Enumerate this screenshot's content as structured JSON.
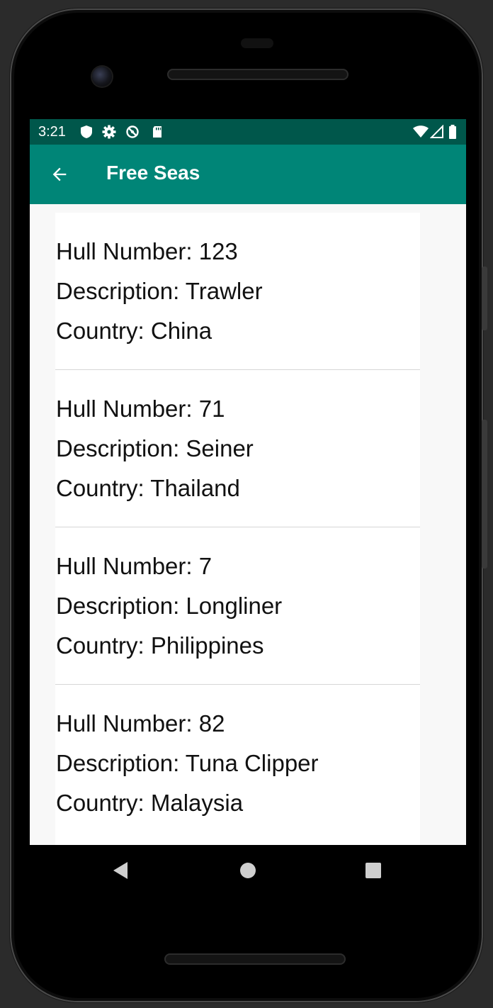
{
  "status_bar": {
    "time": "3:21",
    "icons": [
      "shield-icon",
      "gear-icon",
      "no-sync-icon",
      "sd-card-icon"
    ],
    "right_icons": [
      "wifi-icon",
      "signal-icon",
      "battery-icon"
    ]
  },
  "app_bar": {
    "title": "Free Seas",
    "back_icon": "arrow-back-icon",
    "color": "#008577",
    "status_color": "#00574b"
  },
  "vessels": [
    {
      "hull": "Hull Number: 123",
      "description": "Description: Trawler",
      "country": "Country: China"
    },
    {
      "hull": "Hull Number: 71",
      "description": "Description: Seiner",
      "country": "Country: Thailand"
    },
    {
      "hull": "Hull Number: 7",
      "description": "Description: Longliner",
      "country": "Country: Philippines"
    },
    {
      "hull": "Hull Number: 82",
      "description": "Description: Tuna Clipper",
      "country": "Country: Malaysia"
    }
  ],
  "nav_bar": {
    "buttons": [
      "back-triangle-icon",
      "home-circle-icon",
      "recents-square-icon"
    ]
  }
}
